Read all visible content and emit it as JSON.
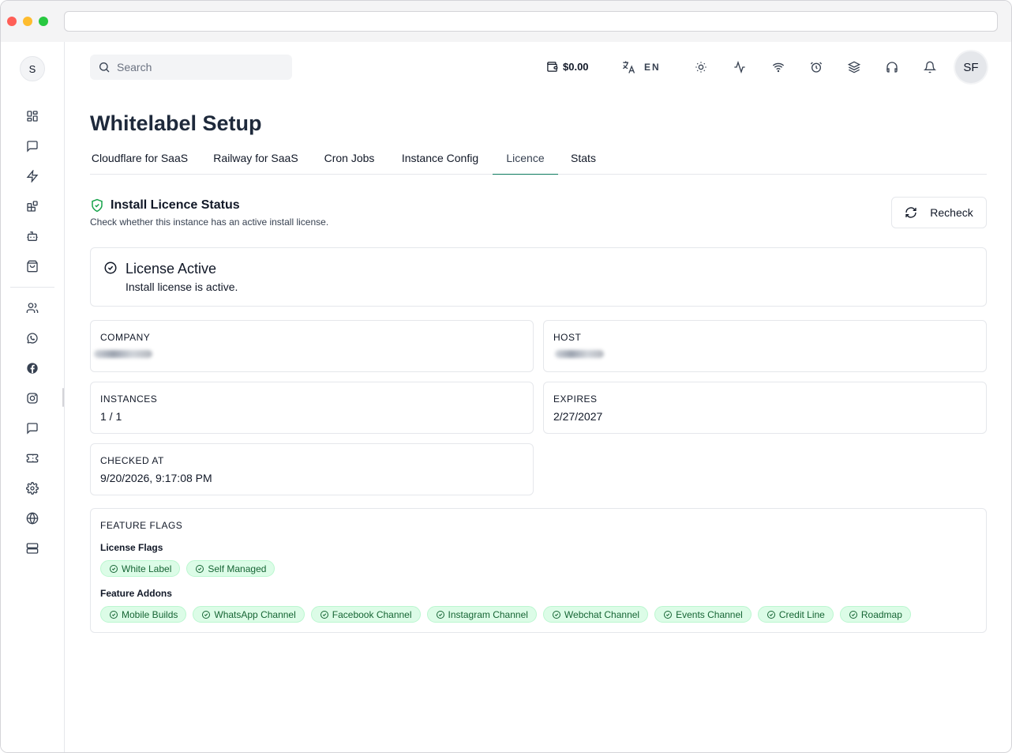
{
  "search": {
    "placeholder": "Search"
  },
  "topbar": {
    "balance": "$0.00",
    "language": "EN",
    "user_initials": "SF"
  },
  "sidebar": {
    "avatar_initial": "S"
  },
  "page": {
    "title": "Whitelabel Setup"
  },
  "tabs": [
    {
      "label": "Cloudflare for SaaS"
    },
    {
      "label": "Railway for SaaS"
    },
    {
      "label": "Cron Jobs"
    },
    {
      "label": "Instance Config"
    },
    {
      "label": "Licence"
    },
    {
      "label": "Stats"
    }
  ],
  "active_tab": "Licence",
  "section": {
    "title": "Install Licence Status",
    "description": "Check whether this instance has an active install license.",
    "recheck_label": "Recheck"
  },
  "status": {
    "title": "License Active",
    "description": "Install license is active."
  },
  "info": {
    "company_label": "COMPANY",
    "host_label": "HOST",
    "instances_label": "INSTANCES",
    "instances_value": "1 / 1",
    "expires_label": "EXPIRES",
    "expires_value": "2/27/2027",
    "checked_label": "CHECKED AT",
    "checked_value": "9/20/2026, 9:17:08 PM"
  },
  "flags": {
    "title": "FEATURE FLAGS",
    "license_flags_title": "License Flags",
    "license_flags": [
      "White Label",
      "Self Managed"
    ],
    "feature_addons_title": "Feature Addons",
    "feature_addons": [
      "Mobile Builds",
      "WhatsApp Channel",
      "Facebook Channel",
      "Instagram Channel",
      "Webchat Channel",
      "Events Channel",
      "Credit Line",
      "Roadmap"
    ]
  },
  "colors": {
    "accent": "#0d7a5f",
    "chip_bg": "#dcfce7",
    "chip_text": "#166534"
  }
}
